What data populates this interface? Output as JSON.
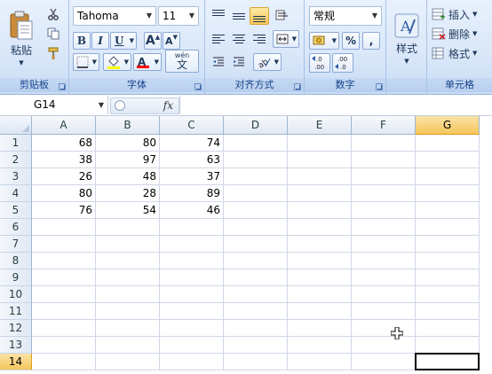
{
  "ribbon": {
    "clipboard": {
      "label": "剪贴板",
      "paste_label": "粘贴"
    },
    "font": {
      "label": "字体",
      "font_name": "Tahoma",
      "font_size": "11",
      "bold": "B",
      "italic": "I",
      "underline": "U",
      "grow_font": "A",
      "shrink_font": "A",
      "font_color_letter": "A",
      "phonetic_label": "wén",
      "phonetic_char": "文"
    },
    "alignment": {
      "label": "对齐方式"
    },
    "number": {
      "label": "数字",
      "format_value": "常规",
      "percent": "%",
      "comma": ",",
      "increase_decimal": "←.0\n.00",
      "decrease_decimal": ".00\n→.0"
    },
    "styles": {
      "label": "样式"
    },
    "cells": {
      "label": "单元格",
      "insert": "插入",
      "delete": "删除",
      "format": "格式"
    }
  },
  "formula_bar": {
    "name_box": "G14",
    "fx": "fx",
    "content": ""
  },
  "sheet": {
    "columns": [
      "A",
      "B",
      "C",
      "D",
      "E",
      "F",
      "G"
    ],
    "rows": [
      "1",
      "2",
      "3",
      "4",
      "5",
      "6",
      "7",
      "8",
      "9",
      "10",
      "11",
      "12",
      "13",
      "14"
    ],
    "values": [
      [
        "68",
        "80",
        "74"
      ],
      [
        "38",
        "97",
        "63"
      ],
      [
        "26",
        "48",
        "37"
      ],
      [
        "80",
        "28",
        "89"
      ],
      [
        "76",
        "54",
        "46"
      ]
    ],
    "selected_column": "G",
    "selected_row": "14",
    "accent_color": "#f5c65c",
    "font_color_bar": "#ff0000",
    "fill_color_bar": "#ffff00"
  }
}
